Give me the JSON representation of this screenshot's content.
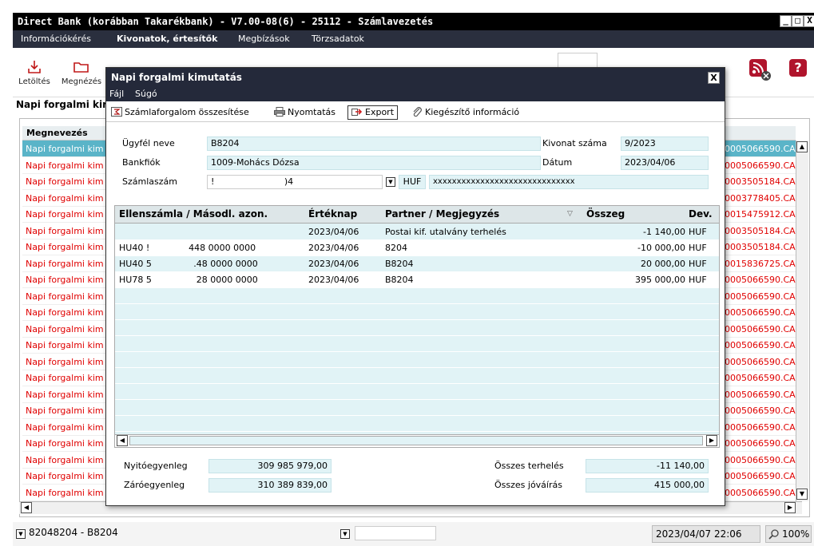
{
  "window": {
    "title": "Direct Bank (korábban Takarékbank) - V7.00-08(6) - 25112 - Számlavezetés",
    "buttons": [
      "_",
      "□",
      "X"
    ]
  },
  "menu": [
    "Információkérés",
    "Kivonatok, értesítők",
    "Megbízások",
    "Törzsadatok"
  ],
  "toolbar": {
    "download": "Letöltés",
    "view": "Megnézés"
  },
  "page_title": "Napi forgalmi kir",
  "list": {
    "header": "Megnevezés",
    "left_text": "Napi forgalmi kim",
    "right_values": [
      "0005066590.CA",
      "0005066590.CA",
      "0003505184.CA",
      "0003778405.CA",
      "0015475912.CA",
      "0003505184.CA",
      "0003505184.CA",
      "0015836725.CA",
      "0005066590.CA",
      "0005066590.CA",
      "0005066590.CA",
      "0005066590.CA",
      "0005066590.CA",
      "0005066590.CA",
      "0005066590.CA",
      "0005066590.CA",
      "0005066590.CA",
      "0005066590.CA",
      "0005066590.CA",
      "0005066590.CA",
      "0005066590.CA",
      "0005066590.CA"
    ]
  },
  "status": {
    "account": "82048204 - B8204",
    "datetime": "2023/04/07 22:06",
    "zoom": "100%"
  },
  "dialog": {
    "title": "Napi forgalmi kimutatás",
    "close": "X",
    "menu": [
      "Fájl",
      "Súgó"
    ],
    "tools": {
      "summary": "Számlaforgalom összesítése",
      "print": "Nyomtatás",
      "export": "Export",
      "extra": "Kiegészítő információ"
    },
    "info": {
      "client_label": "Ügyfél neve",
      "client": "B8204",
      "branch_label": "Bankfiók",
      "branch": "1009-Mohács Dózsa",
      "account_label": "Számlaszám",
      "account": "!                         )4",
      "currency": "HUF",
      "masked": "xxxxxxxxxxxxxxxxxxxxxxxxxxxxxx",
      "statement_label": "Kivonat száma",
      "statement": "9/2023",
      "date_label": "Dátum",
      "date": "2023/04/06"
    },
    "grid": {
      "headers": [
        "Ellenszámla / Másodl. azon.",
        "Értéknap",
        "Partner / Megjegyzés",
        "Összeg",
        "Dev."
      ],
      "rows": [
        {
          "account": "",
          "date": "2023/04/06",
          "partner": "Postai kif. utalvány terhelés",
          "amount": "-1 140,00",
          "cur": "HUF"
        },
        {
          "account": "HU40 !              448 0000 0000",
          "date": "2023/04/06",
          "partner": "8204",
          "amount": "-10 000,00",
          "cur": "HUF"
        },
        {
          "account": "HU40 5               .48 0000 0000",
          "date": "2023/04/06",
          "partner": "B8204",
          "amount": "20 000,00",
          "cur": "HUF"
        },
        {
          "account": "HU78 5                28 0000 0000",
          "date": "2023/04/06",
          "partner": "B8204",
          "amount": "395 000,00",
          "cur": "HUF"
        }
      ]
    },
    "summary": {
      "opening_label": "Nyitóegyenleg",
      "opening": "309 985 979,00",
      "closing_label": "Záróegyenleg",
      "closing": "310 389 839,00",
      "debit_label": "Összes terhelés",
      "debit": "-11 140,00",
      "credit_label": "Összes jóváírás",
      "credit": "415 000,00"
    }
  }
}
